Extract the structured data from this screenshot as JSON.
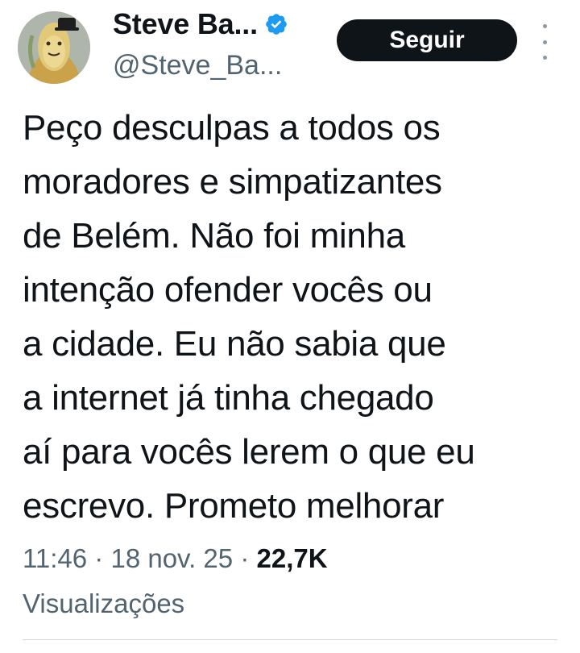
{
  "author": {
    "display_name": "Steve Ba...",
    "handle": "@Steve_Ba...",
    "verified_icon": "verified-badge-icon",
    "verified_color": "#1d9bf0"
  },
  "actions": {
    "follow_label": "Seguir",
    "more_icon": "more-vertical-icon"
  },
  "tweet": {
    "lines": [
      "Peço desculpas a todos os",
      "moradores e simpatizantes",
      "de Belém. Não foi minha",
      "intenção ofender vocês ou",
      "a cidade. Eu não sabia que",
      "a internet já tinha chegado",
      "aí para vocês lerem o que eu",
      "escrevo. Prometo melhorar"
    ]
  },
  "meta": {
    "time": "11:46",
    "separator": " · ",
    "date": "18 nov. 25",
    "views_count": "22,7K",
    "views_label": "Visualizações"
  },
  "colors": {
    "text_primary": "#0f1419",
    "text_secondary": "#536471",
    "button_bg": "#0f1419",
    "divider": "#cfd9de"
  }
}
